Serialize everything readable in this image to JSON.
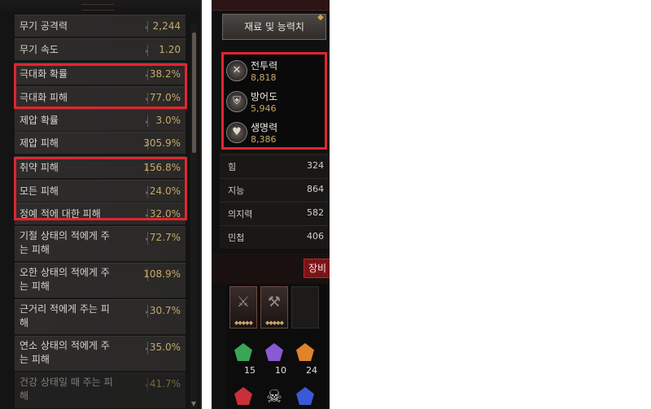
{
  "stats": [
    {
      "name": "무기 공격력",
      "value": "2,244"
    },
    {
      "name": "무기 속도",
      "value": "1.20"
    },
    {
      "name": "극대화 확률",
      "value": "38.2%"
    },
    {
      "name": "극대화 피해",
      "value": "77.0%"
    },
    {
      "name": "제압 확률",
      "value": "3.0%"
    },
    {
      "name": "제압 피해",
      "value": "305.9%"
    },
    {
      "name": "취약 피해",
      "value": "156.8%"
    },
    {
      "name": "모든 피해",
      "value": "24.0%"
    },
    {
      "name": "정예 적에 대한 피해",
      "value": "32.0%"
    },
    {
      "name": "기절 상태의 적에게 주\n는 피해",
      "value": "72.7%"
    },
    {
      "name": "오한 상태의 적에게 주\n는 피해",
      "value": "108.9%"
    },
    {
      "name": "근거리 적에게 주는 피\n해",
      "value": "30.7%"
    },
    {
      "name": "연소 상태의 적에게 주\n는 피해",
      "value": "35.0%"
    },
    {
      "name": "건강 상태일 때 주는 피\n해",
      "value": "41.7%"
    }
  ],
  "materials_button": "재료 및 능력치",
  "power": [
    {
      "label": "전투력",
      "value": "8,818",
      "icon": "crossed-swords-icon"
    },
    {
      "label": "방어도",
      "value": "5,946",
      "icon": "shield-icon"
    },
    {
      "label": "생명력",
      "value": "8,386",
      "icon": "heart-icon"
    }
  ],
  "attributes": [
    {
      "name": "힘",
      "value": "324"
    },
    {
      "name": "지능",
      "value": "864"
    },
    {
      "name": "의지력",
      "value": "582"
    },
    {
      "name": "민첩",
      "value": "406"
    }
  ],
  "equip_tab": "장비",
  "gems": [
    {
      "count": "15",
      "color": "#3aa655"
    },
    {
      "count": "10",
      "color": "#8a5ad2"
    },
    {
      "count": "24",
      "color": "#e0832a"
    }
  ],
  "colors": {
    "highlight": "#e0262e",
    "value_gold": "#c7a86a"
  }
}
